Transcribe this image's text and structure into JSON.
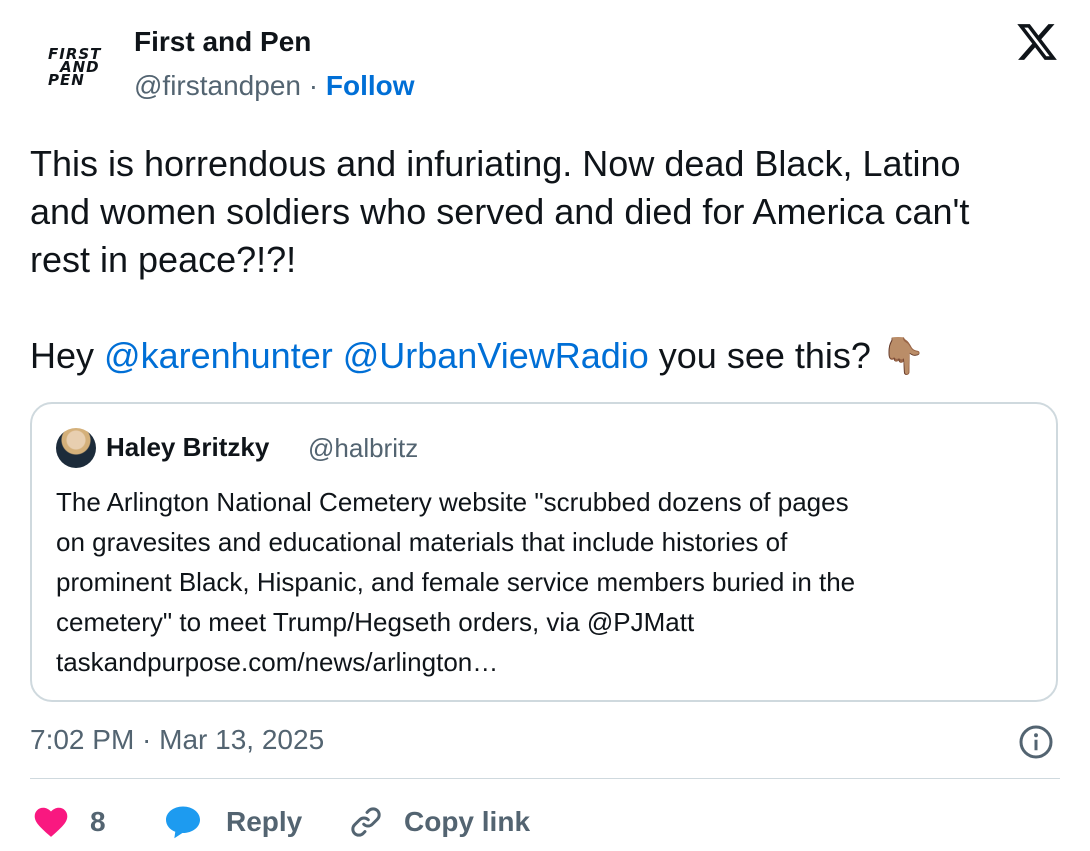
{
  "author": {
    "avatar_lines": [
      "FIRST",
      "AND",
      "PEN"
    ],
    "display_name": "First and Pen",
    "handle": "@firstandpen",
    "separator": "·",
    "follow_label": "Follow"
  },
  "top_bar": {
    "close_icon": "x-logo-icon"
  },
  "tweet": {
    "line1": "This is horrendous and infuriating. Now dead Black, Latino",
    "line2": "and women soldiers who served and died for America can't",
    "line3": "rest in peace?!?!",
    "hey": "Hey ",
    "mention1": "@karenhunter",
    "mention2": "@UrbanViewRadio",
    "tail": " you see this? ",
    "emoji": "👇🏽"
  },
  "quote": {
    "name": "Haley Britzky",
    "handle": "@halbritz",
    "lines": [
      "The Arlington National Cemetery website \"scrubbed dozens of pages",
      "on gravesites and educational materials that include histories of",
      "prominent Black, Hispanic, and female service members buried in the",
      "cemetery\" to meet Trump/Hegseth orders, via @PJMatt",
      "taskandpurpose.com/news/arlington…"
    ]
  },
  "meta": {
    "timestamp": "7:02 PM · Mar 13, 2025"
  },
  "actions": {
    "like_count": "8",
    "reply_label": "Reply",
    "copy_label": "Copy link"
  },
  "colors": {
    "accent": "#006fd6",
    "like": "#f91880",
    "reply": "#1d9bf0",
    "muted": "#536471",
    "text": "#0f1419",
    "border": "#cfd9de"
  }
}
